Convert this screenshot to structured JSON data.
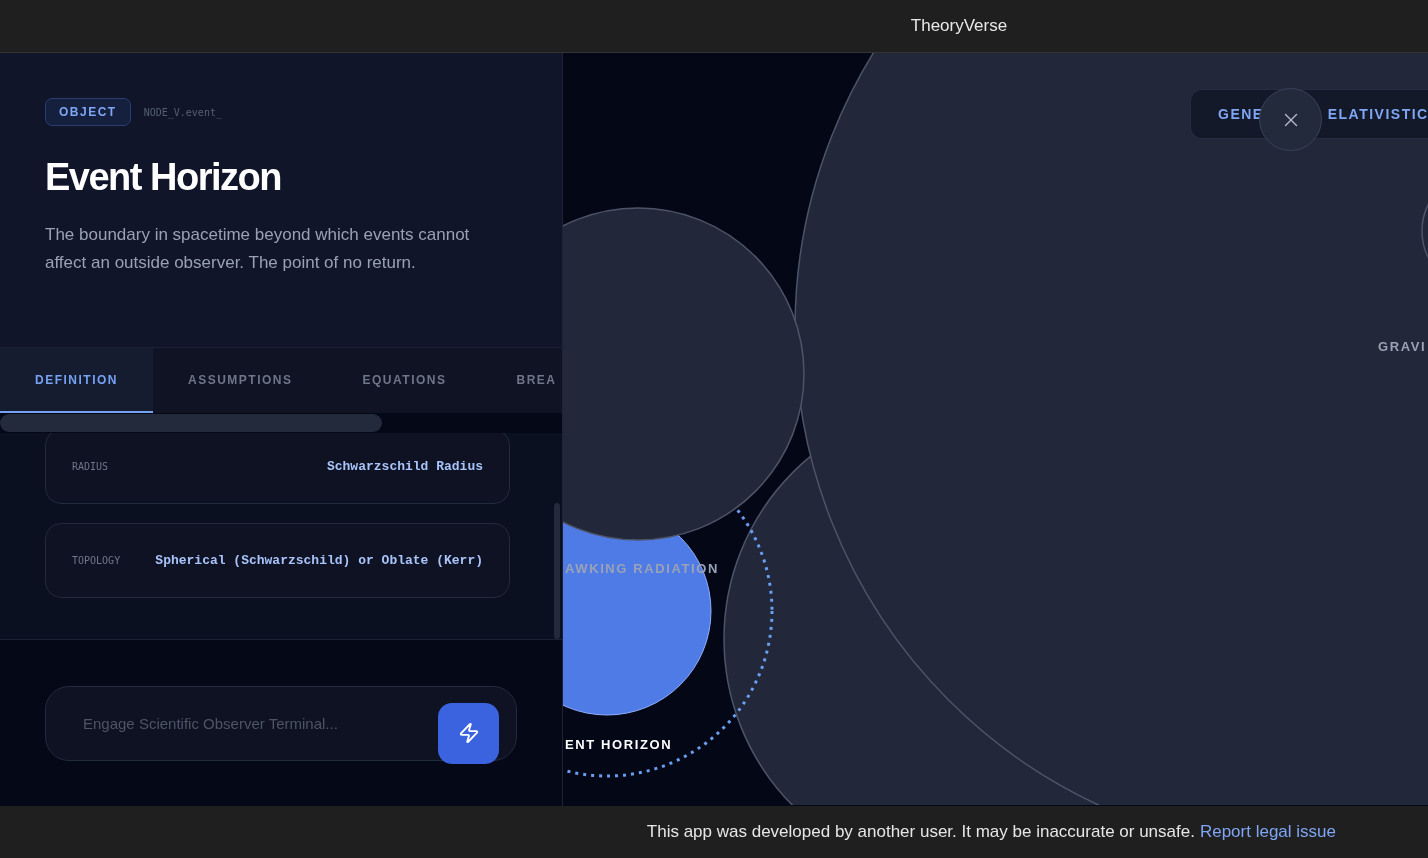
{
  "app_bar": {
    "title": "TheoryVerse"
  },
  "panel": {
    "badge": "OBJECT",
    "node_id": "NODE_V.event_",
    "title": "Event Horizon",
    "description": "The boundary in spacetime beyond which events cannot affect an outside observer. The point of no return.",
    "tabs": [
      {
        "label": "DEFINITION",
        "selected": true
      },
      {
        "label": "ASSUMPTIONS",
        "selected": false
      },
      {
        "label": "EQUATIONS",
        "selected": false
      },
      {
        "label": "BREA",
        "selected": false
      }
    ],
    "properties": [
      {
        "label": "RADIUS",
        "value": "Schwarzschild Radius"
      },
      {
        "label": "TOPOLOGY",
        "value": "Spherical (Schwarzschild) or Oblate (Kerr)"
      }
    ],
    "terminal": {
      "placeholder": "Engage Scientific Observer Terminal..."
    }
  },
  "graph": {
    "pill_parts": [
      "GENE",
      "ELATIVISTIC"
    ],
    "nodes": [
      {
        "label": "AWKING RADIATION",
        "selected": false
      },
      {
        "label": "ENT HORIZON",
        "selected": true
      },
      {
        "label": "GRAVI",
        "selected": false
      }
    ]
  },
  "footer": {
    "notice": "This app was developed by another user. It may be inaccurate or unsafe.",
    "link": "Report legal issue"
  }
}
